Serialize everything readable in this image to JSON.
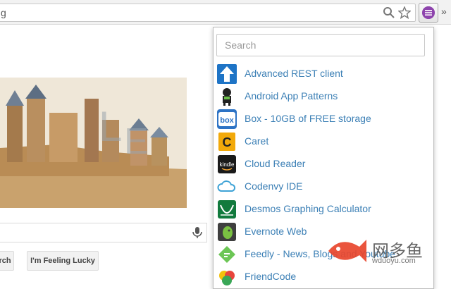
{
  "browser": {
    "address_text": "g",
    "overflow_chevron": "»"
  },
  "google": {
    "search_button": "rch",
    "lucky_button": "I'm Feeling Lucky"
  },
  "extension_popup": {
    "search_placeholder": "Search",
    "items": [
      {
        "label": "Advanced REST client",
        "icon": "arrow-up-icon"
      },
      {
        "label": "Android App Patterns",
        "icon": "android-icon"
      },
      {
        "label": "Box - 10GB of FREE storage",
        "icon": "box-icon"
      },
      {
        "label": "Caret",
        "icon": "caret-icon"
      },
      {
        "label": "Cloud Reader",
        "icon": "kindle-icon"
      },
      {
        "label": "Codenvy IDE",
        "icon": "cloud-icon"
      },
      {
        "label": "Desmos Graphing Calculator",
        "icon": "desmos-icon"
      },
      {
        "label": "Evernote Web",
        "icon": "evernote-icon"
      },
      {
        "label": "Feedly - News, Blogs and Youtube",
        "icon": "feedly-icon"
      },
      {
        "label": "FriendCode",
        "icon": "friendcode-icon"
      }
    ]
  },
  "watermark": {
    "cn": "网多鱼",
    "en": "wduoyu.com"
  },
  "colors": {
    "link": "#3b7fb5",
    "extension_icon": "#8e44ad"
  }
}
